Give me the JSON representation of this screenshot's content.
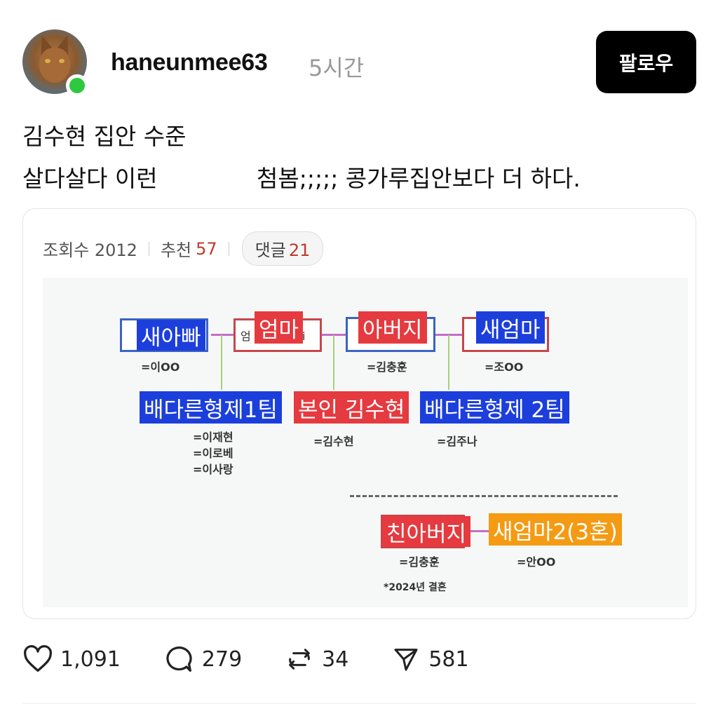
{
  "post": {
    "username": "haneunmee63",
    "time": "5시간",
    "follow_label": "팔로우",
    "line1": "김수현 집안 수준",
    "line2a": "살다살다 이런",
    "line2b": "첨봄;;;;; 콩가루집안보다 더 하다."
  },
  "card": {
    "views_label": "조회수 2012",
    "recommend_label": "추천",
    "recommend_count": "57",
    "comments_label": "댓글",
    "comments_count": "21"
  },
  "diagram": {
    "step_dad": "새아빠",
    "step_dad_name": "=이OO",
    "mom": "엄마",
    "mom_frame_left": "엄",
    "mom_frame_right": "i",
    "father": "아버지",
    "father_name": "=김충훈",
    "step_mom": "새엄마",
    "step_mom_name": "=조OO",
    "team1": "배다른형제1팀",
    "team1_names": "=이재현\n=이로베\n=이사랑",
    "self": "본인 김수현",
    "self_name": "=김수현",
    "team2": "배다른형제 2팀",
    "team2_names": "=김주나",
    "bio_father": "친아버지",
    "bio_father_name": "=김충훈",
    "step_mom2": "새엄마2(3혼)",
    "step_mom2_name": "=안OO",
    "note": "*2024년 결혼"
  },
  "actions": {
    "likes": "1,091",
    "comments": "279",
    "reposts": "34",
    "shares": "581"
  },
  "colors": {
    "blue": "#1c3fdc",
    "red": "#e53a3f",
    "orange": "#f49b13",
    "online": "#2ec93f"
  },
  "icons": [
    "heart-icon",
    "comment-icon",
    "repost-icon",
    "share-icon"
  ]
}
